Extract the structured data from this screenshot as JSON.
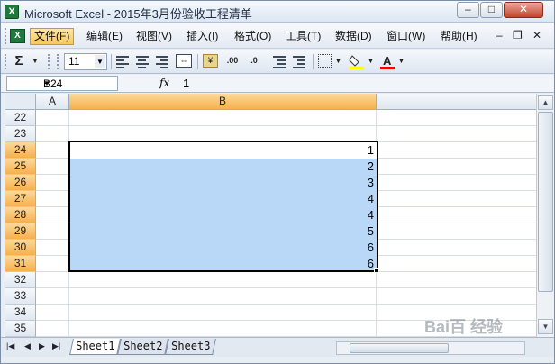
{
  "window": {
    "title": "Microsoft Excel - 2015年3月份验收工程清单",
    "app_icon_glyph": "X",
    "controls": {
      "minimize": "–",
      "maximize": "□",
      "close": "✕"
    }
  },
  "menubar": {
    "items": [
      {
        "label": "文件(F)"
      },
      {
        "label": "编辑(E)"
      },
      {
        "label": "视图(V)"
      },
      {
        "label": "插入(I)"
      },
      {
        "label": "格式(O)"
      },
      {
        "label": "工具(T)"
      },
      {
        "label": "数据(D)"
      },
      {
        "label": "窗口(W)"
      },
      {
        "label": "帮助(H)"
      }
    ],
    "active_index": 0,
    "doc_controls": {
      "minimize": "–",
      "restore": "❐",
      "close": "✕"
    }
  },
  "toolbar": {
    "autosum": "Σ",
    "font_size": "11",
    "icons": [
      "autosum-icon",
      "align-left-icon",
      "align-center-icon",
      "align-right-icon",
      "merge-center-icon",
      "currency-icon",
      "increase-decimal-icon",
      "decrease-decimal-icon",
      "decrease-indent-icon",
      "increase-indent-icon",
      "borders-icon",
      "fill-color-icon",
      "font-color-icon"
    ],
    "decimal_inc_label": ".00",
    "decimal_dec_label": ".0",
    "fill_color": "#ffff00",
    "font_color": "#ff0000",
    "font_color_glyph": "A"
  },
  "formula_bar": {
    "name_box": "B24",
    "fx_label": "fx",
    "value": "1"
  },
  "grid": {
    "columns": [
      {
        "label": "",
        "selected": false
      },
      {
        "label": "A",
        "selected": false
      },
      {
        "label": "B",
        "selected": true
      }
    ],
    "rows": [
      {
        "number": "22",
        "selected": false,
        "b": ""
      },
      {
        "number": "23",
        "selected": false,
        "b": ""
      },
      {
        "number": "24",
        "selected": true,
        "b": "1"
      },
      {
        "number": "25",
        "selected": true,
        "b": "2"
      },
      {
        "number": "26",
        "selected": true,
        "b": "3"
      },
      {
        "number": "27",
        "selected": true,
        "b": "4"
      },
      {
        "number": "28",
        "selected": true,
        "b": "4"
      },
      {
        "number": "29",
        "selected": true,
        "b": "5"
      },
      {
        "number": "30",
        "selected": true,
        "b": "6"
      },
      {
        "number": "31",
        "selected": true,
        "b": "6"
      },
      {
        "number": "32",
        "selected": false,
        "b": ""
      },
      {
        "number": "33",
        "selected": false,
        "b": ""
      },
      {
        "number": "34",
        "selected": false,
        "b": ""
      },
      {
        "number": "35",
        "selected": false,
        "b": ""
      }
    ],
    "selection_color": "#b9d7f6",
    "header_selected_color": "#f6b04d"
  },
  "sheet_tabs": {
    "nav": [
      "|◀",
      "◀",
      "▶",
      "▶|"
    ],
    "tabs": [
      {
        "label": "Sheet1",
        "active": true
      },
      {
        "label": "Sheet2",
        "active": false
      },
      {
        "label": "Sheet3",
        "active": false
      }
    ]
  },
  "watermark": "Bai百 经验"
}
